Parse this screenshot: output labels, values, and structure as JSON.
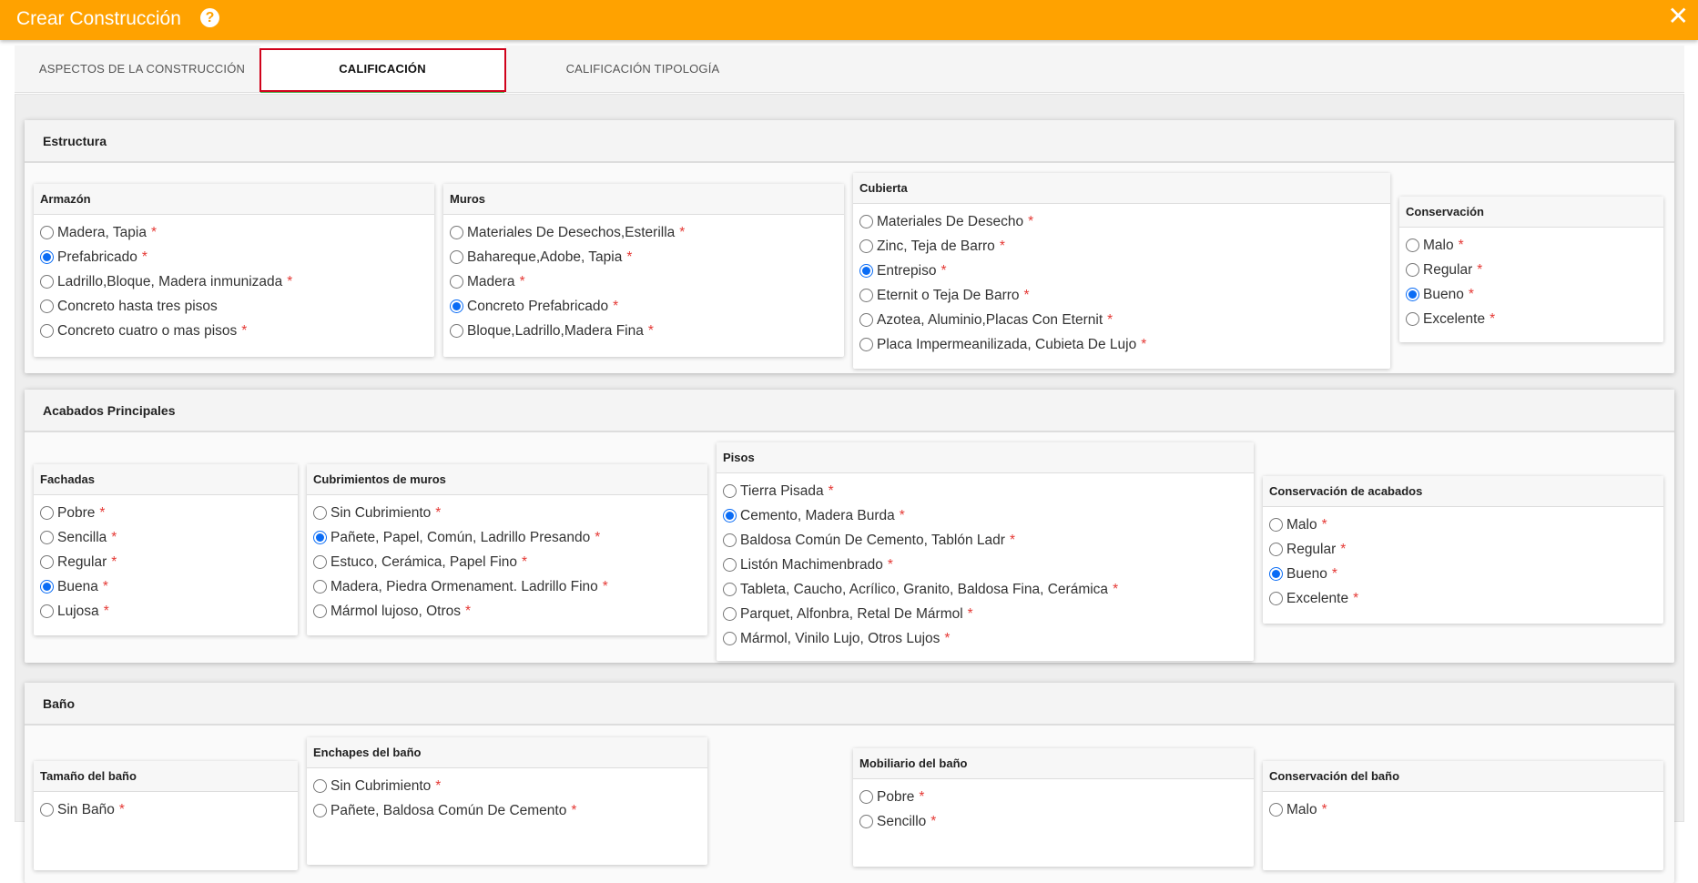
{
  "window": {
    "title": "Crear Construcción",
    "help_icon": "?",
    "close_icon": "✕"
  },
  "tabs": [
    {
      "label": "ASPECTOS DE LA CONSTRUCCIÓN"
    },
    {
      "label": "CALIFICACIÓN"
    },
    {
      "label": "CALIFICACIÓN TIPOLOGÍA"
    }
  ],
  "sections": {
    "estructura": {
      "title": "Estructura",
      "cards": {
        "armazon": {
          "title": "Armazón",
          "options": [
            "Madera, Tapia",
            "Prefabricado",
            "Ladrillo,Bloque, Madera inmunizada",
            "Concreto hasta tres pisos",
            "Concreto cuatro o mas pisos"
          ],
          "required": [
            true,
            true,
            true,
            false,
            true
          ],
          "selected": 1
        },
        "muros": {
          "title": "Muros",
          "options": [
            "Materiales De Desechos,Esterilla",
            "Bahareque,Adobe, Tapia",
            "Madera",
            "Concreto Prefabricado",
            "Bloque,Ladrillo,Madera Fina"
          ],
          "required": [
            true,
            true,
            true,
            true,
            true
          ],
          "selected": 3
        },
        "cubierta": {
          "title": "Cubierta",
          "options": [
            "Materiales De Desecho",
            "Zinc, Teja de Barro",
            "Entrepiso",
            "Eternit o Teja De Barro",
            "Azotea, Aluminio,Placas Con Eternit",
            "Placa Impermeanilizada, Cubieta De Lujo"
          ],
          "required": [
            true,
            true,
            true,
            true,
            true,
            true
          ],
          "selected": 2
        },
        "conservacion": {
          "title": "Conservación",
          "options": [
            "Malo",
            "Regular",
            "Bueno",
            "Excelente"
          ],
          "required": [
            true,
            true,
            true,
            true
          ],
          "selected": 2
        }
      }
    },
    "acabados": {
      "title": "Acabados Principales",
      "cards": {
        "fachadas": {
          "title": "Fachadas",
          "options": [
            "Pobre",
            "Sencilla",
            "Regular",
            "Buena",
            "Lujosa"
          ],
          "required": [
            true,
            true,
            true,
            true,
            true
          ],
          "selected": 3
        },
        "cubrimientos": {
          "title": "Cubrimientos de muros",
          "options": [
            "Sin Cubrimiento",
            "Pañete, Papel, Común, Ladrillo Presando",
            "Estuco, Cerámica, Papel Fino",
            "Madera, Piedra Ormenament. Ladrillo Fino",
            "Mármol lujoso, Otros"
          ],
          "required": [
            true,
            true,
            true,
            true,
            true
          ],
          "selected": 1
        },
        "pisos": {
          "title": "Pisos",
          "options": [
            "Tierra Pisada",
            "Cemento, Madera Burda",
            "Baldosa Común De Cemento, Tablón Ladr",
            "Listón Machimenbrado",
            "Tableta, Caucho, Acrílico, Granito, Baldosa Fina, Cerámica",
            "Parquet, Alfonbra, Retal De Mármol",
            "Mármol, Vinilo Lujo, Otros Lujos"
          ],
          "required": [
            true,
            true,
            true,
            true,
            true,
            true,
            true
          ],
          "selected": 1
        },
        "conservacion_acabados": {
          "title": "Conservación de acabados",
          "options": [
            "Malo",
            "Regular",
            "Bueno",
            "Excelente"
          ],
          "required": [
            true,
            true,
            true,
            true
          ],
          "selected": 2
        }
      }
    },
    "bano": {
      "title": "Baño",
      "cards": {
        "tamano": {
          "title": "Tamaño del baño",
          "options": [
            "Sin Baño"
          ],
          "required": [
            true
          ],
          "selected": -1
        },
        "enchapes": {
          "title": "Enchapes del baño",
          "options": [
            "Sin Cubrimiento",
            "Pañete, Baldosa Común De Cemento"
          ],
          "required": [
            true,
            true
          ],
          "selected": -1
        },
        "mobiliario": {
          "title": "Mobiliario del baño",
          "options": [
            "Pobre",
            "Sencillo"
          ],
          "required": [
            true,
            true
          ],
          "selected": -1
        },
        "conservacion_bano": {
          "title": "Conservación del baño",
          "options": [
            "Malo"
          ],
          "required": [
            true
          ],
          "selected": -1
        }
      }
    }
  }
}
